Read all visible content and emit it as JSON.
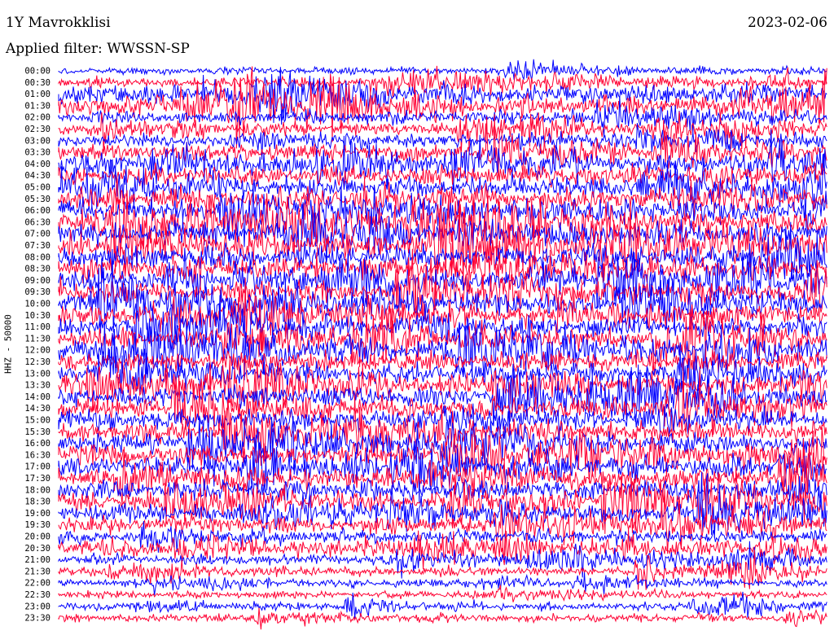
{
  "header": {
    "station": "1Y Mavrokklisi",
    "date": "2023-02-06",
    "filter": "Applied filter: WWSSN-SP"
  },
  "colors": {
    "trace_a": "#0000ff",
    "trace_b": "#ff0033",
    "background": "#ffffff"
  },
  "chart_data": {
    "type": "line",
    "ylabel": "HHZ - 50000",
    "row_labels": [
      "00:00",
      "00:30",
      "01:00",
      "01:30",
      "02:00",
      "02:30",
      "03:00",
      "03:30",
      "04:00",
      "04:30",
      "05:00",
      "05:30",
      "06:00",
      "06:30",
      "07:00",
      "07:30",
      "08:00",
      "08:30",
      "09:00",
      "09:30",
      "10:00",
      "10:30",
      "11:00",
      "11:30",
      "12:00",
      "12:30",
      "13:00",
      "13:30",
      "14:00",
      "14:30",
      "15:00",
      "15:30",
      "16:00",
      "16:30",
      "17:00",
      "17:30",
      "18:00",
      "18:30",
      "19:00",
      "19:30",
      "20:00",
      "20:30",
      "21:00",
      "21:30",
      "22:00",
      "22:30",
      "23:00",
      "23:30"
    ],
    "row_colors": [
      "blue",
      "red"
    ],
    "series": [
      {
        "values": [
          1.0,
          1.4,
          2.6,
          2.6,
          1.8,
          1.6,
          1.8,
          2.4,
          2.6,
          2.6,
          2.8,
          2.8,
          3.0,
          3.0,
          3.2,
          3.2,
          3.2,
          3.2,
          3.0,
          3.0,
          3.0,
          2.8,
          2.6,
          2.6,
          2.6,
          2.6,
          2.6,
          2.6,
          2.6,
          2.6,
          2.6,
          2.6,
          2.6,
          2.6,
          2.6,
          2.6,
          2.6,
          2.6,
          2.4,
          2.2,
          1.8,
          1.6,
          1.4,
          1.2,
          1.0,
          1.0,
          1.0,
          1.0
        ]
      }
    ]
  }
}
